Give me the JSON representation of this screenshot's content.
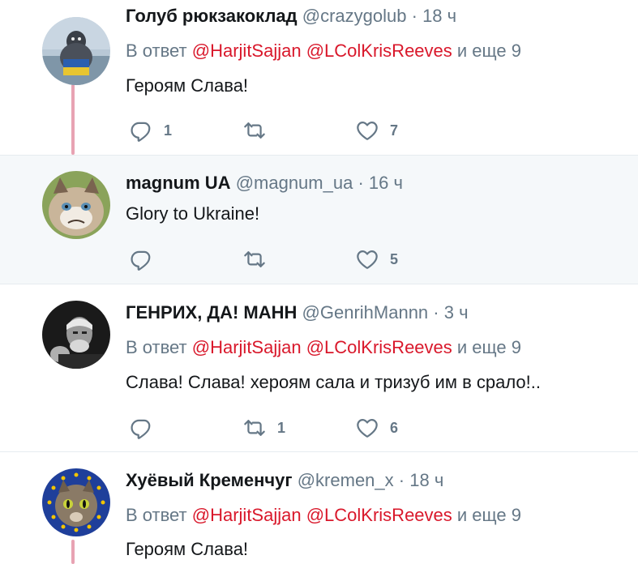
{
  "colors": {
    "name": "#14171a",
    "meta": "#657786",
    "mention": "#d9182b",
    "thread_line": "#e8a3b3",
    "highlight_bg": "#f5f8fa"
  },
  "tweets": [
    {
      "name": "Голуб рюкзакоклад",
      "handle": "@crazygolub",
      "dot": "·",
      "time": "18 ч",
      "reply_prefix": "В ответ",
      "mention1": "@HarjitSajjan",
      "mention2": "@LColKrisReeves",
      "reply_suffix": "и еще 9",
      "text": "Героям Слава!",
      "reply_count": "1",
      "retweet_count": "",
      "like_count": "7",
      "avatar_icon": "pigeon-avatar"
    },
    {
      "name": "magnum UA",
      "handle": "@magnum_ua",
      "dot": "·",
      "time": "16 ч",
      "text": "Glory to Ukraine!",
      "reply_count": "",
      "retweet_count": "",
      "like_count": "5",
      "avatar_icon": "grumpy-cat-avatar"
    },
    {
      "name": "ГЕНРИХ, ДА! МАНН",
      "handle": "@GenrihMannn",
      "dot": "·",
      "time": "3 ч",
      "reply_prefix": "В ответ",
      "mention1": "@HarjitSajjan",
      "mention2": "@LColKrisReeves",
      "reply_suffix": "и еще 9",
      "text": "Слава! Слава! хероям сала и тризуб им в срало!..",
      "reply_count": "",
      "retweet_count": "1",
      "like_count": "6",
      "avatar_icon": "man-portrait-avatar"
    },
    {
      "name": "Хуёвый Кременчуг",
      "handle": "@kremen_x",
      "dot": "·",
      "time": "18 ч",
      "reply_prefix": "В ответ",
      "mention1": "@HarjitSajjan",
      "mention2": "@LColKrisReeves",
      "reply_suffix": "и еще 9",
      "text": "Героям Слава!",
      "avatar_icon": "eu-cat-avatar"
    }
  ]
}
